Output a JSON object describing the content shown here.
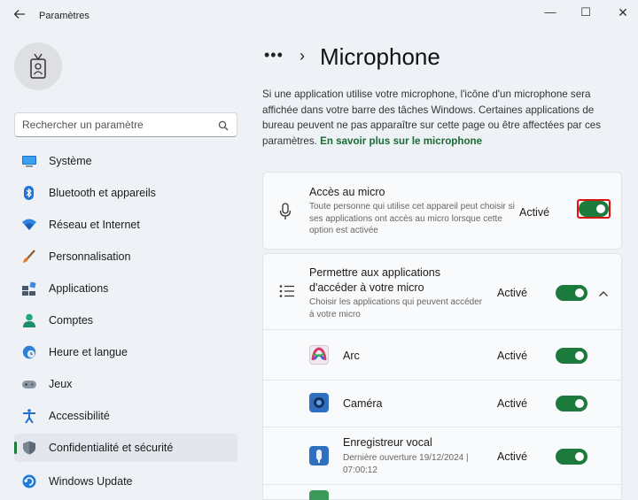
{
  "window": {
    "title": "Paramètres",
    "back_icon": "back-arrow-icon",
    "min_glyph": "—",
    "max_glyph": "☐",
    "close_glyph": "✕"
  },
  "search": {
    "placeholder": "Rechercher un paramètre"
  },
  "sidebar": {
    "items": [
      {
        "label": "Système",
        "icon": "system-icon"
      },
      {
        "label": "Bluetooth et appareils",
        "icon": "bluetooth-icon"
      },
      {
        "label": "Réseau et Internet",
        "icon": "network-icon"
      },
      {
        "label": "Personnalisation",
        "icon": "brush-icon"
      },
      {
        "label": "Applications",
        "icon": "apps-icon"
      },
      {
        "label": "Comptes",
        "icon": "account-icon"
      },
      {
        "label": "Heure et langue",
        "icon": "clock-globe-icon"
      },
      {
        "label": "Jeux",
        "icon": "gamepad-icon"
      },
      {
        "label": "Accessibilité",
        "icon": "accessibility-icon"
      },
      {
        "label": "Confidentialité et sécurité",
        "icon": "shield-icon",
        "active": true
      },
      {
        "label": "Windows Update",
        "icon": "update-icon"
      }
    ]
  },
  "header": {
    "dots": "•••",
    "chevron": "›",
    "title": "Microphone"
  },
  "description": {
    "text": "Si une application utilise votre microphone, l'icône d'un microphone sera affichée dans votre barre des tâches Windows. Certaines applications de bureau peuvent ne pas apparaître sur cette page ou être affectées par ces paramètres.",
    "link": "En savoir plus sur le microphone"
  },
  "mic_access": {
    "title": "Accès au micro",
    "subtitle": "Toute personne qui utilise cet appareil peut choisir si ses applications ont accès au micro lorsque cette option est activée",
    "state": "Activé",
    "on": true
  },
  "apps_access": {
    "title_line1": "Permettre aux applications",
    "title_line2": "d'accéder à votre micro",
    "subtitle": "Choisir les applications qui peuvent accéder à votre micro",
    "state": "Activé",
    "on": true,
    "expand_glyph": "⌃"
  },
  "apps": [
    {
      "name": "Arc",
      "state": "Activé",
      "on": true,
      "icon": "arc-app-icon"
    },
    {
      "name": "Caméra",
      "state": "Activé",
      "on": true,
      "icon": "camera-app-icon"
    },
    {
      "name": "Enregistreur vocal",
      "last_used": "Dernière ouverture 19/12/2024 | 07:00:12",
      "state": "Activé",
      "on": true,
      "icon": "voice-recorder-icon"
    }
  ],
  "colors": {
    "accent": "#1d7a3d",
    "focus_ring": "#dd1111",
    "link": "#1a6a33"
  }
}
